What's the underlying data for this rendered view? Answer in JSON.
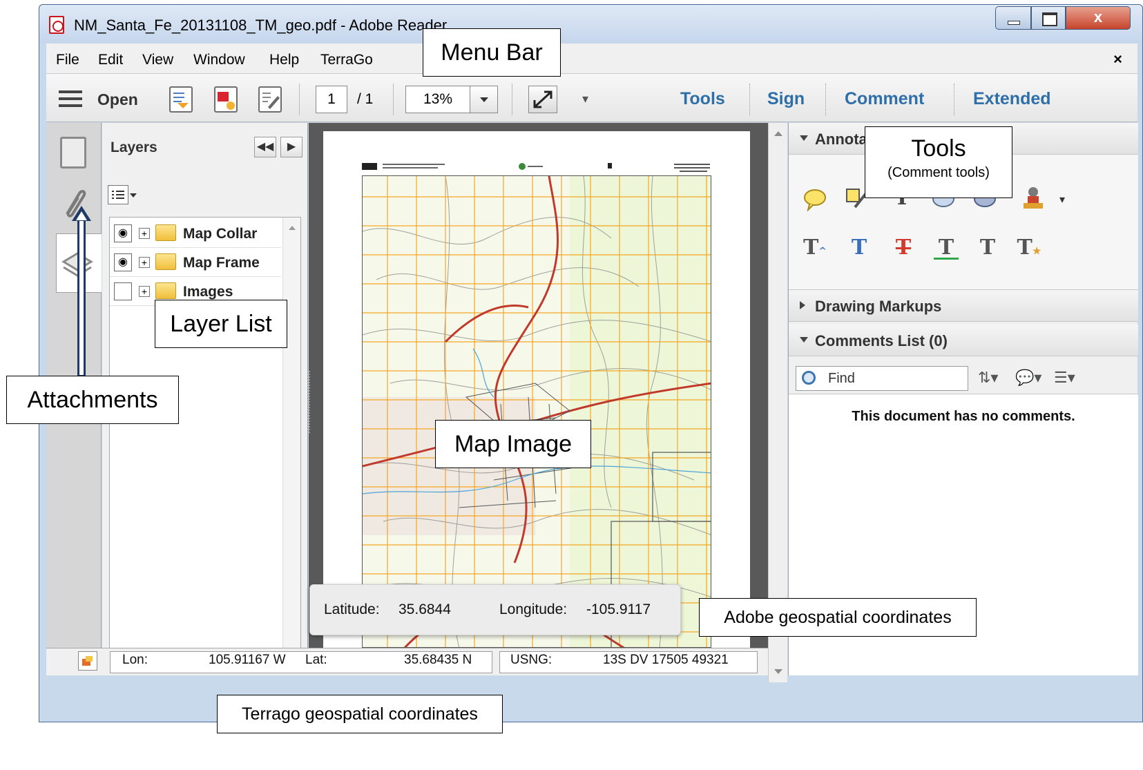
{
  "window": {
    "title": "NM_Santa_Fe_20131108_TM_geo.pdf - Adobe Reader",
    "close_glyph": "x"
  },
  "menubar": {
    "items": [
      "File",
      "Edit",
      "View",
      "Window",
      "Help",
      "TerraGo"
    ],
    "close_glyph": "×"
  },
  "toolbar": {
    "open_label": "Open",
    "page_current": "1",
    "page_total": "/ 1",
    "zoom": "13%",
    "tabs": [
      "Tools",
      "Sign",
      "Comment",
      "Extended"
    ]
  },
  "layers_panel": {
    "title": "Layers",
    "collapse_glyph": "◀◀",
    "next_glyph": "▶",
    "layers": [
      {
        "name": "Map Collar",
        "visible": true
      },
      {
        "name": "Map Frame",
        "visible": true
      },
      {
        "name": "Images",
        "visible": false
      }
    ]
  },
  "geo_popup": {
    "latitude_label": "Latitude:",
    "latitude_value": "35.6844",
    "longitude_label": "Longitude:",
    "longitude_value": "-105.9117"
  },
  "statusbar": {
    "lon_label": "Lon:",
    "lon_value": "105.91167 W",
    "lat_label": "Lat:",
    "lat_value": "35.68435 N",
    "usng_label": "USNG:",
    "usng_value": "13S DV 17505 49321"
  },
  "right_pane": {
    "annotations_title": "Annota",
    "drawing_markups_title": "Drawing Markups",
    "comments_list_title": "Comments List (0)",
    "find_placeholder": "Find",
    "no_comments": "This document has no comments."
  },
  "callouts": {
    "menu_bar": "Menu Bar",
    "tools_title": "Tools",
    "tools_sub": "(Comment tools)",
    "layer_list": "Layer List",
    "attachments": "Attachments",
    "map_image": "Map Image",
    "adobe_coords": "Adobe geospatial coordinates",
    "terrago_coords": "Terrago geospatial coordinates"
  },
  "colors": {
    "tab_blue": "#2f6fa8",
    "title_bar": "#c5d6ec",
    "close_red": "#c8442c",
    "map_grid": "#f5a623",
    "map_road": "#c0392b"
  }
}
